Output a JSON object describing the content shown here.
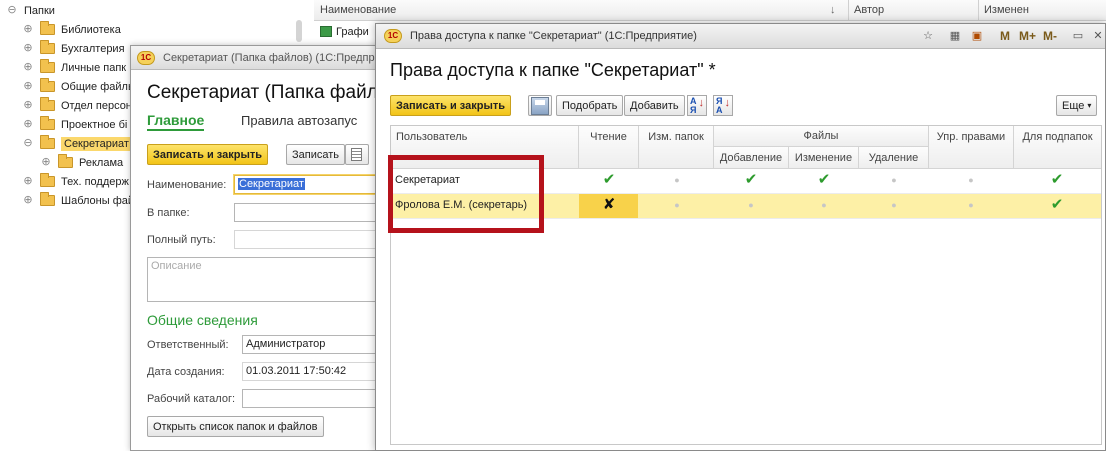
{
  "tree": {
    "root_label": "Папки",
    "items": [
      {
        "label": "Библиотека"
      },
      {
        "label": "Бухгалтерия"
      },
      {
        "label": "Личные папк"
      },
      {
        "label": "Общие файль"
      },
      {
        "label": "Отдел персон"
      },
      {
        "label": "Проектное бі"
      },
      {
        "label": "Секретариат"
      },
      {
        "label": "Реклама"
      },
      {
        "label": "Тех. поддерж"
      },
      {
        "label": "Шаблоны фай"
      }
    ]
  },
  "list": {
    "columns": [
      "Наименование",
      "Автор",
      "Изменен"
    ],
    "first_row_label": "Графи"
  },
  "card": {
    "title": "Секретариат (Папка файлов)  (1С:Предпр",
    "heading": "Секретариат (Папка файло",
    "tabs": [
      "Главное",
      "Правила автозапус"
    ],
    "buttons": {
      "save_close": "Записать и закрыть",
      "save": "Записать",
      "open_list": "Открыть список папок и файлов"
    },
    "labels": {
      "name": "Наименование:",
      "folder": "В папке:",
      "path": "Полный путь:",
      "responsible": "Ответственный:",
      "created": "Дата создания:",
      "workdir": "Рабочий каталог:"
    },
    "values": {
      "name": "Секретариат",
      "responsible": "Администратор",
      "created": "01.03.2011 17:50:42"
    },
    "description_placeholder": "Описание",
    "section_title": "Общие сведения"
  },
  "rights": {
    "title": "Права доступа к папке \"Секретариат\"  (1С:Предприятие)",
    "heading": "Права доступа к папке \"Секретариат\" *",
    "toolbar": {
      "save_close": "Записать и закрыть",
      "pick": "Подобрать",
      "add": "Добавить",
      "more": "Еще"
    },
    "titlebar_m": [
      "M",
      "M+",
      "M-"
    ],
    "columns": {
      "user": "Пользователь",
      "read": "Чтение",
      "edit_folders": "Изм. папок",
      "files": "Файлы",
      "files_add": "Добавление",
      "files_change": "Изменение",
      "files_delete": "Удаление",
      "manage_rights": "Упр. правами",
      "subfolders": "Для подпапок"
    },
    "rows": [
      {
        "user": "Секретариат",
        "read": "on",
        "edit_folders": "off",
        "files_add": "on",
        "files_change": "on",
        "files_delete": "off",
        "manage_rights": "off",
        "subfolders": "on"
      },
      {
        "user": "Фролова Е.М. (секретарь)",
        "read": "deny",
        "edit_folders": "off",
        "files_add": "off",
        "files_change": "off",
        "files_delete": "off",
        "manage_rights": "off",
        "subfolders": "on"
      }
    ]
  },
  "colors": {
    "accent_green": "#2e9b3a",
    "primary_button": "#f2c418",
    "highlight_row": "#fdf0a6",
    "annotation_red": "#b5121b"
  }
}
